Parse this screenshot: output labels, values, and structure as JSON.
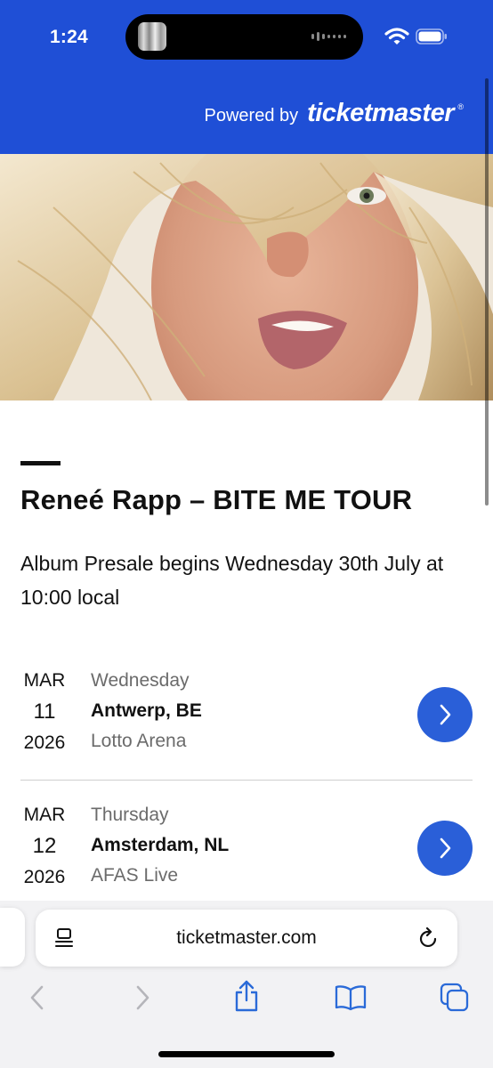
{
  "status_bar": {
    "time": "1:24"
  },
  "header": {
    "powered_by": "Powered by",
    "brand": "ticketmaster",
    "registered": "®"
  },
  "hero": {
    "icon": "artist-photo"
  },
  "event": {
    "title": "Reneé Rapp – BITE ME TOUR",
    "presale_text": "Album Presale begins Wednesday 30th July at 10:00 local"
  },
  "dates": [
    {
      "month": "MAR",
      "day": "11",
      "year": "2026",
      "weekday": "Wednesday",
      "city": "Antwerp, BE",
      "venue": "Lotto Arena"
    },
    {
      "month": "MAR",
      "day": "12",
      "year": "2026",
      "weekday": "Thursday",
      "city": "Amsterdam, NL",
      "venue": "AFAS Live"
    }
  ],
  "browser": {
    "url": "ticketmaster.com"
  },
  "colors": {
    "brand_blue": "#1f4fd6",
    "button_blue": "#2a5fd8"
  }
}
